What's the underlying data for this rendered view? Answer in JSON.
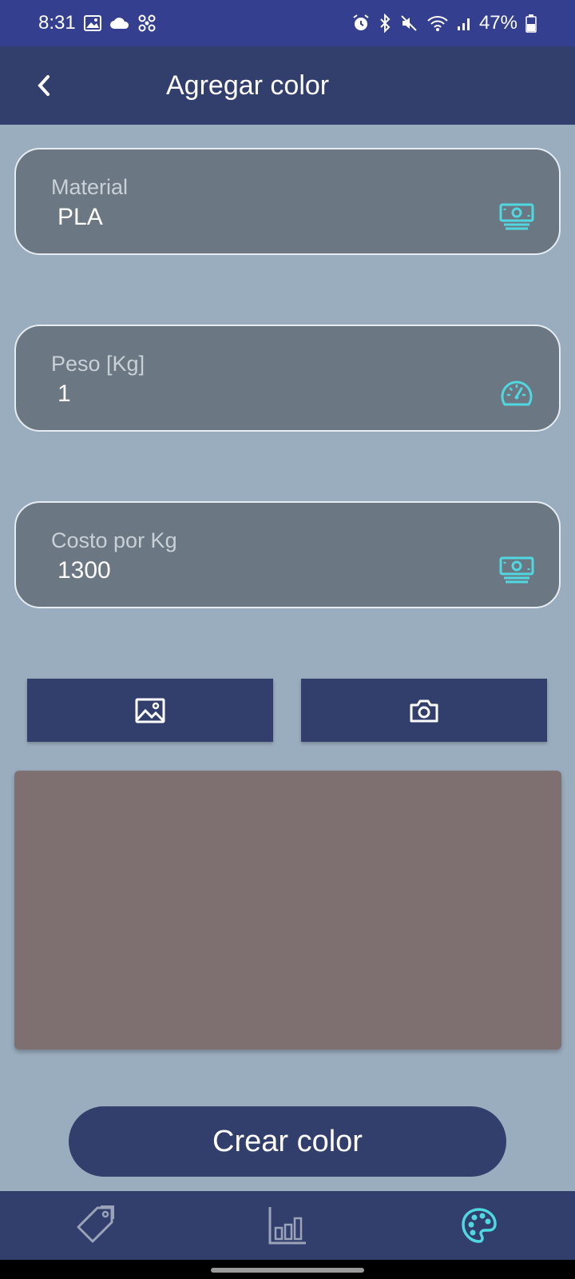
{
  "status_bar": {
    "time": "8:31",
    "battery": "47%",
    "left_icons": [
      "gallery-icon",
      "cloud-icon",
      "fan-icon"
    ],
    "right_icons": [
      "alarm-icon",
      "bluetooth-icon",
      "mute-icon",
      "wifi-icon",
      "signal-icon",
      "battery-icon"
    ]
  },
  "app_bar": {
    "title": "Agregar color",
    "back_icon": "chevron-left-icon"
  },
  "form": {
    "material": {
      "label": "Material",
      "value": "PLA",
      "icon": "money-icon"
    },
    "weight": {
      "label": "Peso [Kg]",
      "value": "1",
      "icon": "speedometer-icon"
    },
    "cost": {
      "label": "Costo por Kg",
      "value": "1300",
      "icon": "money-icon"
    }
  },
  "media_buttons": {
    "gallery_icon": "image-icon",
    "camera_icon": "camera-icon"
  },
  "preview": {
    "color": "#7e7070"
  },
  "actions": {
    "create_label": "Crear color"
  },
  "bottom_nav": {
    "items": [
      {
        "icon": "tag-icon",
        "active": false
      },
      {
        "icon": "bar-chart-icon",
        "active": false
      },
      {
        "icon": "palette-icon",
        "active": true
      }
    ]
  },
  "colors": {
    "accent": "#4fd8e0",
    "primary": "#323f6c",
    "background": "#9aadbf",
    "field": "#6b7782"
  }
}
